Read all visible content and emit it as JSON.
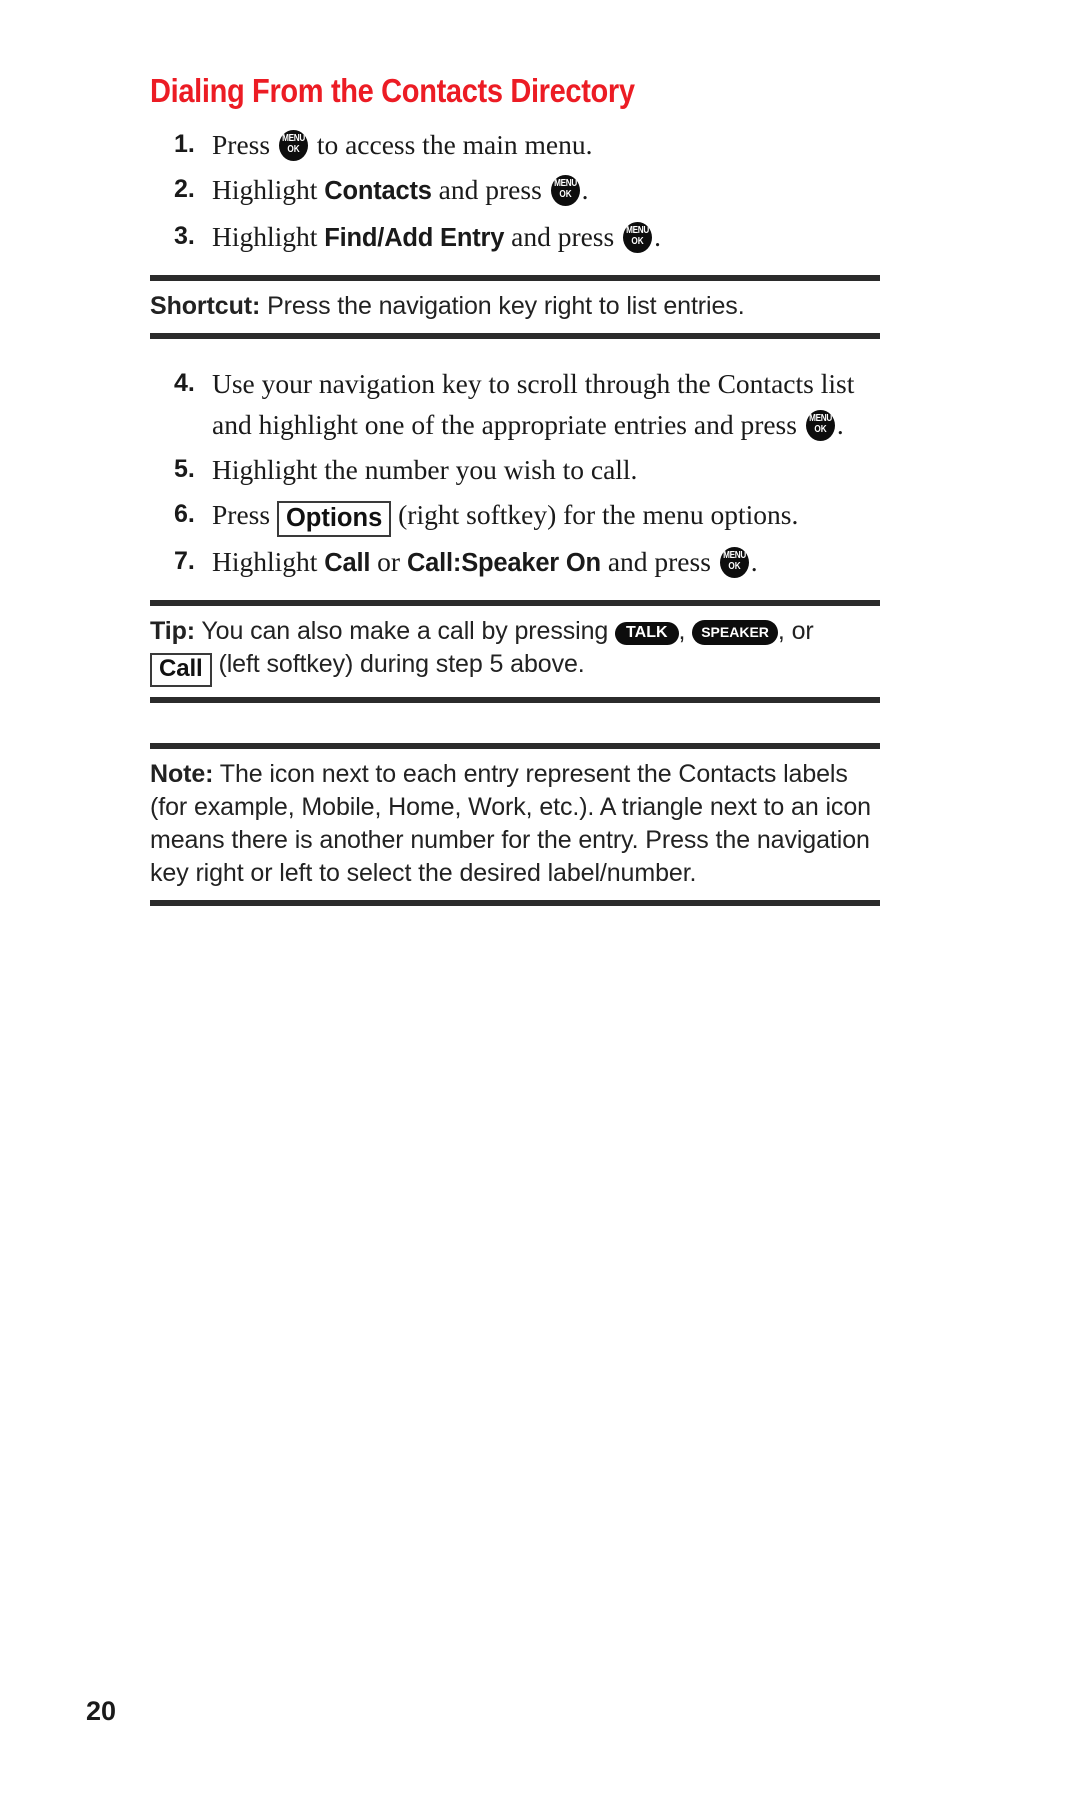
{
  "page": {
    "number": "20"
  },
  "heading": {
    "title": "Dialing From the Contacts Directory",
    "color": "#ec1c24"
  },
  "icons": {
    "menu_ok": {
      "line1": "MENU",
      "line2": "OK"
    },
    "talk": "TALK",
    "speaker": "SPEAKER",
    "options_softkey": "Options",
    "call_softkey": "Call"
  },
  "steps": [
    {
      "num": "1.",
      "parts": [
        {
          "type": "text",
          "value": "Press "
        },
        {
          "type": "menu-key"
        },
        {
          "type": "text",
          "value": " to access the main menu."
        }
      ],
      "plain": "Press [MENU OK] to access the main menu."
    },
    {
      "num": "2.",
      "parts": [
        {
          "type": "text",
          "value": "Highlight "
        },
        {
          "type": "bold",
          "value": "Contacts"
        },
        {
          "type": "text",
          "value": " and press "
        },
        {
          "type": "menu-key"
        },
        {
          "type": "text",
          "value": "."
        }
      ],
      "plain": "Highlight Contacts and press [MENU OK]."
    },
    {
      "num": "3.",
      "parts": [
        {
          "type": "text",
          "value": "Highlight "
        },
        {
          "type": "bold",
          "value": "Find/Add Entry"
        },
        {
          "type": "text",
          "value": " and press "
        },
        {
          "type": "menu-key"
        },
        {
          "type": "text",
          "value": "."
        }
      ],
      "plain": "Highlight Find/Add Entry and press [MENU OK]."
    },
    {
      "num": "4.",
      "parts": [
        {
          "type": "text",
          "value": "Use your navigation key to scroll through the Contacts list and highlight one of the appropriate entries and press "
        },
        {
          "type": "menu-key"
        },
        {
          "type": "text",
          "value": "."
        }
      ],
      "plain": "Use your navigation key to scroll through the Contacts list and highlight one of the appropriate entries and press [MENU OK]."
    },
    {
      "num": "5.",
      "parts": [
        {
          "type": "text",
          "value": "Highlight the number you wish to call."
        }
      ],
      "plain": "Highlight the number you wish to call."
    },
    {
      "num": "6.",
      "parts": [
        {
          "type": "text",
          "value": "Press "
        },
        {
          "type": "box-key",
          "value": "Options"
        },
        {
          "type": "text",
          "value": " (right softkey) for the menu options."
        }
      ],
      "plain": "Press [Options] (right softkey) for the menu options."
    },
    {
      "num": "7.",
      "parts": [
        {
          "type": "text",
          "value": "Highlight "
        },
        {
          "type": "bold",
          "value": "Call"
        },
        {
          "type": "text",
          "value": " or "
        },
        {
          "type": "bold",
          "value": "Call:Speaker On"
        },
        {
          "type": "text",
          "value": " and press "
        },
        {
          "type": "menu-key"
        },
        {
          "type": "text",
          "value": "."
        }
      ],
      "plain": "Highlight Call or Call:Speaker On and press [MENU OK]."
    }
  ],
  "shortcut": {
    "label": "Shortcut:",
    "text": "Press the navigation key right to list entries."
  },
  "tip": {
    "label": "Tip:",
    "text_before_talk": "You can also make a call by pressing ",
    "comma_1": ", ",
    "comma_2": ", or ",
    "text_after_call": " (left softkey) during step 5 above.",
    "plain": "Tip: You can also make a call by pressing TALK, SPEAKER, or Call (left softkey) during step 5 above."
  },
  "note": {
    "label": "Note:",
    "text": "The icon next to each entry represent the Contacts labels (for example, Mobile, Home, Work, etc.). A triangle next to an icon means there is another number for the entry. Press the navigation key right or left to select the desired label/number."
  }
}
